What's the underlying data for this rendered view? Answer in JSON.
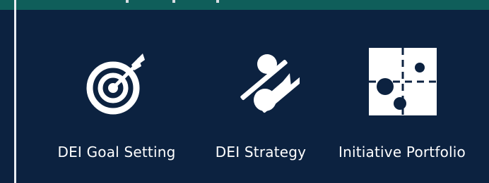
{
  "cards": [
    {
      "label": "DEI Goal Setting",
      "icon": "target-icon"
    },
    {
      "label": "DEI Strategy",
      "icon": "strategy-connector-icon"
    },
    {
      "label": "Initiative Portfolio",
      "icon": "portfolio-matrix-icon"
    }
  ],
  "colors": {
    "background": "#0c2240",
    "header_band": "#0f5e5a",
    "icon": "#ffffff",
    "text": "#ffffff"
  }
}
